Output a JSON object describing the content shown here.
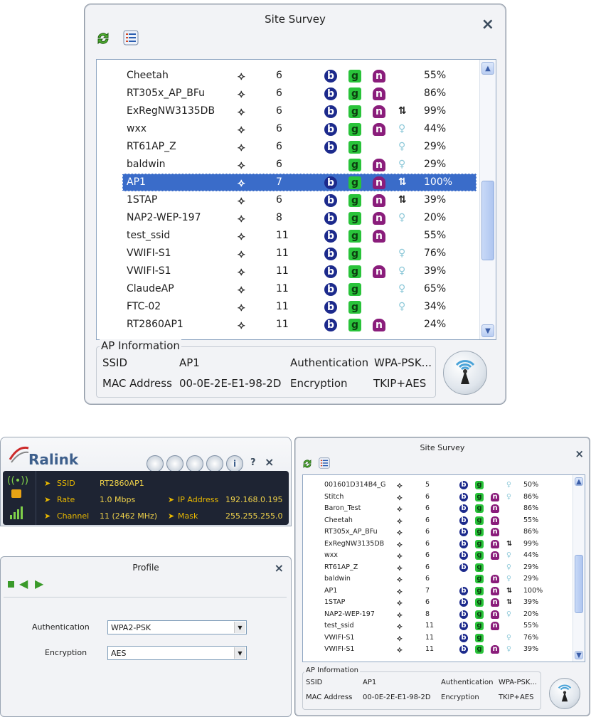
{
  "top_survey": {
    "title": "Site Survey",
    "close_label": "×",
    "networks": [
      {
        "ssid": "Cheetah",
        "channel": "6",
        "b": true,
        "g": true,
        "n": true,
        "wps": false,
        "bulb": false,
        "signal": "55%"
      },
      {
        "ssid": "RT305x_AP_BFu",
        "channel": "6",
        "b": true,
        "g": true,
        "n": true,
        "wps": false,
        "bulb": false,
        "signal": "86%"
      },
      {
        "ssid": "ExRegNW3135DB",
        "channel": "6",
        "b": true,
        "g": true,
        "n": true,
        "wps": true,
        "bulb": false,
        "signal": "99%"
      },
      {
        "ssid": "wxx",
        "channel": "6",
        "b": true,
        "g": true,
        "n": true,
        "wps": false,
        "bulb": true,
        "signal": "44%"
      },
      {
        "ssid": "RT61AP_Z",
        "channel": "6",
        "b": true,
        "g": true,
        "n": false,
        "wps": false,
        "bulb": true,
        "signal": "29%"
      },
      {
        "ssid": "baldwin",
        "channel": "6",
        "b": false,
        "g": true,
        "n": true,
        "wps": false,
        "bulb": true,
        "signal": "29%"
      },
      {
        "ssid": "AP1",
        "channel": "7",
        "b": true,
        "g": true,
        "n": true,
        "wps": true,
        "bulb": false,
        "signal": "100%",
        "selected": true
      },
      {
        "ssid": "1STAP",
        "channel": "6",
        "b": true,
        "g": true,
        "n": true,
        "wps": true,
        "bulb": false,
        "signal": "39%"
      },
      {
        "ssid": "NAP2-WEP-197",
        "channel": "8",
        "b": true,
        "g": true,
        "n": true,
        "wps": false,
        "bulb": true,
        "signal": "20%"
      },
      {
        "ssid": "test_ssid",
        "channel": "11",
        "b": true,
        "g": true,
        "n": true,
        "wps": false,
        "bulb": false,
        "signal": "55%"
      },
      {
        "ssid": "VWIFI-S1",
        "channel": "11",
        "b": true,
        "g": true,
        "n": false,
        "wps": false,
        "bulb": true,
        "signal": "76%"
      },
      {
        "ssid": "VWIFI-S1",
        "channel": "11",
        "b": true,
        "g": true,
        "n": true,
        "wps": false,
        "bulb": true,
        "signal": "39%"
      },
      {
        "ssid": "ClaudeAP",
        "channel": "11",
        "b": true,
        "g": true,
        "n": false,
        "wps": false,
        "bulb": true,
        "signal": "65%"
      },
      {
        "ssid": "FTC-02",
        "channel": "11",
        "b": true,
        "g": true,
        "n": false,
        "wps": false,
        "bulb": true,
        "signal": "34%"
      },
      {
        "ssid": "RT2860AP1",
        "channel": "11",
        "b": true,
        "g": true,
        "n": true,
        "wps": false,
        "bulb": false,
        "signal": "24%"
      }
    ],
    "ap_info": {
      "legend": "AP Information",
      "ssid_label": "SSID",
      "ssid_value": "AP1",
      "auth_label": "Authentication",
      "auth_value": "WPA-PSK...",
      "mac_label": "MAC Address",
      "mac_value": "00-0E-2E-E1-98-2D",
      "enc_label": "Encryption",
      "enc_value": "TKIP+AES"
    }
  },
  "ralink": {
    "brand": "Ralink",
    "help_label": "?",
    "close_label": "×",
    "status": {
      "ssid_label": "SSID",
      "ssid_value": "RT2860AP1",
      "rate_label": "Rate",
      "rate_value": "1.0 Mbps",
      "channel_label": "Channel",
      "channel_value": "11 (2462 MHz)",
      "ip_label": "IP Address",
      "ip_value": "192.168.0.195",
      "mask_label": "Mask",
      "mask_value": "255.255.255.0"
    },
    "profile": {
      "title": "Profile",
      "close_label": "×",
      "auth_label": "Authentication",
      "auth_value": "WPA2-PSK",
      "enc_label": "Encryption",
      "enc_value": "AES"
    }
  },
  "bottom_survey": {
    "title": "Site Survey",
    "close_label": "×",
    "networks": [
      {
        "ssid": "001601D314B4_G",
        "channel": "5",
        "b": true,
        "g": true,
        "n": false,
        "wps": false,
        "bulb": true,
        "signal": "50%"
      },
      {
        "ssid": "Stitch",
        "channel": "6",
        "b": true,
        "g": true,
        "n": true,
        "wps": false,
        "bulb": true,
        "signal": "86%"
      },
      {
        "ssid": "Baron_Test",
        "channel": "6",
        "b": true,
        "g": true,
        "n": true,
        "wps": false,
        "bulb": false,
        "signal": "86%"
      },
      {
        "ssid": "Cheetah",
        "channel": "6",
        "b": true,
        "g": true,
        "n": true,
        "wps": false,
        "bulb": false,
        "signal": "55%"
      },
      {
        "ssid": "RT305x_AP_BFu",
        "channel": "6",
        "b": true,
        "g": true,
        "n": true,
        "wps": false,
        "bulb": false,
        "signal": "86%"
      },
      {
        "ssid": "ExRegNW3135DB",
        "channel": "6",
        "b": true,
        "g": true,
        "n": true,
        "wps": true,
        "bulb": false,
        "signal": "99%"
      },
      {
        "ssid": "wxx",
        "channel": "6",
        "b": true,
        "g": true,
        "n": true,
        "wps": false,
        "bulb": true,
        "signal": "44%"
      },
      {
        "ssid": "RT61AP_Z",
        "channel": "6",
        "b": true,
        "g": true,
        "n": false,
        "wps": false,
        "bulb": true,
        "signal": "29%"
      },
      {
        "ssid": "baldwin",
        "channel": "6",
        "b": false,
        "g": true,
        "n": true,
        "wps": false,
        "bulb": true,
        "signal": "29%"
      },
      {
        "ssid": "AP1",
        "channel": "7",
        "b": true,
        "g": true,
        "n": true,
        "wps": true,
        "bulb": false,
        "signal": "100%"
      },
      {
        "ssid": "1STAP",
        "channel": "6",
        "b": true,
        "g": true,
        "n": true,
        "wps": true,
        "bulb": false,
        "signal": "39%"
      },
      {
        "ssid": "NAP2-WEP-197",
        "channel": "8",
        "b": true,
        "g": true,
        "n": true,
        "wps": false,
        "bulb": true,
        "signal": "20%"
      },
      {
        "ssid": "test_ssid",
        "channel": "11",
        "b": true,
        "g": true,
        "n": true,
        "wps": false,
        "bulb": false,
        "signal": "55%"
      },
      {
        "ssid": "VWIFI-S1",
        "channel": "11",
        "b": true,
        "g": true,
        "n": false,
        "wps": false,
        "bulb": true,
        "signal": "76%"
      },
      {
        "ssid": "VWIFI-S1",
        "channel": "11",
        "b": true,
        "g": true,
        "n": true,
        "wps": false,
        "bulb": true,
        "signal": "39%"
      }
    ],
    "ap_info": {
      "legend": "AP Information",
      "ssid_label": "SSID",
      "ssid_value": "AP1",
      "auth_label": "Authentication",
      "auth_value": "WPA-PSK...",
      "mac_label": "MAC Address",
      "mac_value": "00-0E-2E-E1-98-2D",
      "enc_label": "Encryption",
      "enc_value": "TKIP+AES"
    }
  },
  "icons": {
    "refresh": "refresh-icon",
    "list": "list-icon",
    "wps_pin": "wps-lock-icon",
    "wps_pbc": "wps-pbc-icon",
    "bulb": "bulb-icon",
    "connect": "antenna-icon"
  },
  "colors": {
    "selection": "#3a6cc9",
    "b_badge": "#1c2a8c",
    "g_badge": "#29c33a",
    "n_badge": "#8a1d7b",
    "status_label": "#e8b800",
    "status_value": "#f0d24a"
  }
}
